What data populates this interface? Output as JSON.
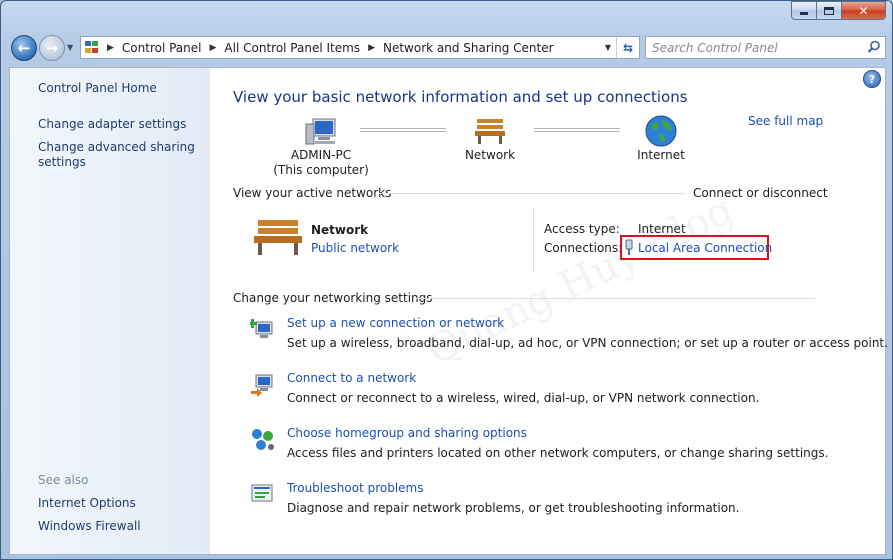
{
  "window": {
    "controls": {
      "minimize": "minimize",
      "maximize": "maximize",
      "close": "close"
    }
  },
  "nav": {
    "breadcrumb": [
      "Control Panel",
      "All Control Panel Items",
      "Network and Sharing Center"
    ],
    "search_placeholder": "Search Control Panel"
  },
  "sidebar": {
    "home": "Control Panel Home",
    "change_adapter": "Change adapter settings",
    "change_advanced_line1": "Change advanced sharing",
    "change_advanced_line2": "settings",
    "see_also": "See also",
    "internet_options": "Internet Options",
    "windows_firewall": "Windows Firewall"
  },
  "main": {
    "title": "View your basic network information and set up connections",
    "see_full_map": "See full map",
    "map": {
      "computer_line1": "ADMIN-PC",
      "computer_line2": "(This computer)",
      "network": "Network",
      "internet": "Internet"
    },
    "active": {
      "heading": "View your active networks",
      "connect_link": "Connect or disconnect",
      "network_name": "Network",
      "network_type": "Public network",
      "access_type_label": "Access type:",
      "access_type_value": "Internet",
      "connections_label": "Connections:",
      "connections_value": "Local Area Connection"
    },
    "settings": {
      "heading": "Change your networking settings",
      "tasks": [
        {
          "title": "Set up a new connection or network",
          "desc": "Set up a wireless, broadband, dial-up, ad hoc, or VPN connection; or set up a router or access point."
        },
        {
          "title": "Connect to a network",
          "desc": "Connect or reconnect to a wireless, wired, dial-up, or VPN network connection."
        },
        {
          "title": "Choose homegroup and sharing options",
          "desc": "Access files and printers located on other network computers, or change sharing settings."
        },
        {
          "title": "Troubleshoot problems",
          "desc": "Diagnose and repair network problems, or get troubleshooting information."
        }
      ]
    },
    "watermark": "Quang Huy Blog"
  },
  "colors": {
    "link": "#1c4fb5",
    "title": "#1e3287",
    "highlight_box": "#d6141e"
  }
}
